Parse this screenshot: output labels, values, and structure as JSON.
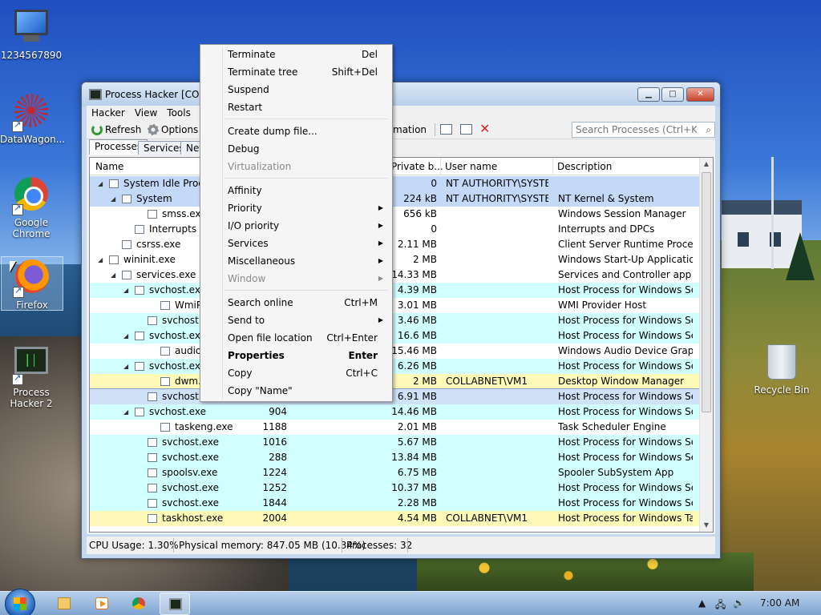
{
  "desktop": {
    "icons": [
      {
        "label": "1234567890",
        "icon": "computer-icon"
      },
      {
        "label": "DataWagon...",
        "icon": "datawagon-icon"
      },
      {
        "label": "Google Chrome",
        "icon": "chrome-icon"
      },
      {
        "label": "Firefox",
        "icon": "firefox-icon"
      },
      {
        "label": "Process Hacker 2",
        "icon": "process-hacker-icon"
      },
      {
        "label": "Recycle Bin",
        "icon": "recycle-bin-icon"
      }
    ]
  },
  "window": {
    "title": "Process Hacker [COLLA",
    "controls": {
      "minimize": "▁",
      "maximize": "□",
      "close": "✕"
    },
    "menu": [
      "Hacker",
      "View",
      "Tools"
    ],
    "toolbar": {
      "refresh": "Refresh",
      "options": "Options",
      "system_information": "mation",
      "search_placeholder": "Search Processes (Ctrl+K)"
    },
    "tabs": [
      "Processes",
      "Services",
      "Netw"
    ],
    "columns": [
      "Name",
      "Private b...",
      "User name",
      "Description"
    ],
    "rows": [
      {
        "name": "System Idle Proce",
        "pid": "",
        "private": "0",
        "user": "NT AUTHORITY\\SYSTEM",
        "desc": "",
        "level": 0,
        "expander": "◢",
        "color": "sys"
      },
      {
        "name": "System",
        "pid": "",
        "private": "224 kB",
        "user": "NT AUTHORITY\\SYSTEM",
        "desc": "NT Kernel & System",
        "level": 1,
        "expander": "◢",
        "color": "sys"
      },
      {
        "name": "smss.exe",
        "pid": "",
        "private": "656 kB",
        "user": "",
        "desc": "Windows Session Manager",
        "level": 3,
        "expander": "",
        "color": ""
      },
      {
        "name": "Interrupts",
        "pid": "",
        "private": "0",
        "user": "",
        "desc": "Interrupts and DPCs",
        "level": 2,
        "expander": "",
        "color": ""
      },
      {
        "name": "csrss.exe",
        "pid": "",
        "private": "2.11 MB",
        "user": "",
        "desc": "Client Server Runtime Process",
        "level": 1,
        "expander": "",
        "color": ""
      },
      {
        "name": "wininit.exe",
        "pid": "",
        "private": "2 MB",
        "user": "",
        "desc": "Windows Start-Up Application",
        "level": 0,
        "expander": "◢",
        "color": ""
      },
      {
        "name": "services.exe",
        "pid": "",
        "private": "14.33 MB",
        "user": "",
        "desc": "Services and Controller app",
        "level": 1,
        "expander": "◢",
        "color": ""
      },
      {
        "name": "svchost.exe",
        "pid": "",
        "private": "4.39 MB",
        "user": "",
        "desc": "Host Process for Windows Ser...",
        "level": 2,
        "expander": "◢",
        "color": "svc"
      },
      {
        "name": "WmiPrvS",
        "pid": "",
        "private": "3.01 MB",
        "user": "",
        "desc": "WMI Provider Host",
        "level": 4,
        "expander": "",
        "color": ""
      },
      {
        "name": "svchost.exe",
        "pid": "",
        "private": "3.46 MB",
        "user": "",
        "desc": "Host Process for Windows Ser...",
        "level": 3,
        "expander": "",
        "color": "svc"
      },
      {
        "name": "svchost.exe",
        "pid": "",
        "private": "16.6 MB",
        "user": "",
        "desc": "Host Process for Windows Ser...",
        "level": 2,
        "expander": "◢",
        "color": "svc"
      },
      {
        "name": "audiodg.",
        "pid": "",
        "private": "15.46 MB",
        "user": "",
        "desc": "Windows Audio Device Graph...",
        "level": 4,
        "expander": "",
        "color": ""
      },
      {
        "name": "svchost.exe",
        "pid": "",
        "private": "6.26 MB",
        "user": "",
        "desc": "Host Process for Windows Ser...",
        "level": 2,
        "expander": "◢",
        "color": "svc"
      },
      {
        "name": "dwm.exe",
        "pid": "",
        "private": "2 MB",
        "user": "COLLABNET\\VM1",
        "desc": "Desktop Window Manager",
        "level": 4,
        "expander": "",
        "color": "own"
      },
      {
        "name": "svchost.exe",
        "pid": "",
        "private": "6.91 MB",
        "user": "",
        "desc": "Host Process for Windows Ser...",
        "level": 3,
        "expander": "",
        "color": "sel"
      },
      {
        "name": "svchost.exe",
        "pid": "904",
        "private": "14.46 MB",
        "user": "",
        "desc": "Host Process for Windows Ser...",
        "level": 2,
        "expander": "◢",
        "color": "svc"
      },
      {
        "name": "taskeng.exe",
        "pid": "1188",
        "private": "2.01 MB",
        "user": "",
        "desc": "Task Scheduler Engine",
        "level": 4,
        "expander": "",
        "color": ""
      },
      {
        "name": "svchost.exe",
        "pid": "1016",
        "private": "5.67 MB",
        "user": "",
        "desc": "Host Process for Windows Ser...",
        "level": 3,
        "expander": "",
        "color": "svc"
      },
      {
        "name": "svchost.exe",
        "pid": "288",
        "private": "13.84 MB",
        "user": "",
        "desc": "Host Process for Windows Ser...",
        "level": 3,
        "expander": "",
        "color": "svc"
      },
      {
        "name": "spoolsv.exe",
        "pid": "1224",
        "private": "6.75 MB",
        "user": "",
        "desc": "Spooler SubSystem App",
        "level": 3,
        "expander": "",
        "color": "svc"
      },
      {
        "name": "svchost.exe",
        "pid": "1252",
        "private": "10.37 MB",
        "user": "",
        "desc": "Host Process for Windows Ser...",
        "level": 3,
        "expander": "",
        "color": "svc"
      },
      {
        "name": "svchost.exe",
        "pid": "1844",
        "private": "2.28 MB",
        "user": "",
        "desc": "Host Process for Windows Ser...",
        "level": 3,
        "expander": "",
        "color": "svc"
      },
      {
        "name": "taskhost.exe",
        "pid": "2004",
        "private": "4.54 MB",
        "user": "COLLABNET\\VM1",
        "desc": "Host Process for Windows Tas...",
        "level": 3,
        "expander": "",
        "color": "own"
      }
    ],
    "status": {
      "cpu": "CPU Usage: 1.30%",
      "memory": "Physical memory: 847.05 MB (10.34%)",
      "processes": "Processes: 32"
    }
  },
  "context_menu": {
    "groups": [
      [
        {
          "label": "Terminate",
          "shortcut": "Del"
        },
        {
          "label": "Terminate tree",
          "shortcut": "Shift+Del"
        },
        {
          "label": "Suspend",
          "shortcut": ""
        },
        {
          "label": "Restart",
          "shortcut": ""
        }
      ],
      [
        {
          "label": "Create dump file...",
          "shortcut": ""
        },
        {
          "label": "Debug",
          "shortcut": ""
        },
        {
          "label": "Virtualization",
          "shortcut": "",
          "disabled": true
        }
      ],
      [
        {
          "label": "Affinity",
          "shortcut": ""
        },
        {
          "label": "Priority",
          "shortcut": "",
          "submenu": true
        },
        {
          "label": "I/O priority",
          "shortcut": "",
          "submenu": true
        },
        {
          "label": "Services",
          "shortcut": "",
          "submenu": true
        },
        {
          "label": "Miscellaneous",
          "shortcut": "",
          "submenu": true
        },
        {
          "label": "Window",
          "shortcut": "",
          "submenu": true,
          "disabled": true
        }
      ],
      [
        {
          "label": "Search online",
          "shortcut": "Ctrl+M"
        },
        {
          "label": "Send to",
          "shortcut": "",
          "submenu": true
        },
        {
          "label": "Open file location",
          "shortcut": "Ctrl+Enter"
        },
        {
          "label": "Properties",
          "shortcut": "Enter",
          "bold": true
        },
        {
          "label": "Copy",
          "shortcut": "Ctrl+C"
        },
        {
          "label": "Copy \"Name\"",
          "shortcut": ""
        }
      ]
    ]
  },
  "taskbar": {
    "apps": [
      "file-explorer-icon",
      "media-player-icon",
      "chrome-icon",
      "process-hacker-icon"
    ],
    "clock": "7:00 AM"
  }
}
